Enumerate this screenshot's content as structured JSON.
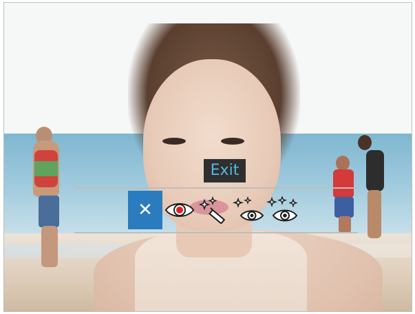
{
  "tooltip": {
    "text": "Exit"
  },
  "toolbar": {
    "tools": [
      {
        "name": "close",
        "icon": "close-icon",
        "active": true
      },
      {
        "name": "red-eye",
        "icon": "red-eye-icon",
        "active": false
      },
      {
        "name": "magic-wand",
        "icon": "magic-wand-icon",
        "active": false
      },
      {
        "name": "sparkle-eye",
        "icon": "sparkle-eye-icon",
        "active": false
      },
      {
        "name": "sparkle-eye-plus",
        "icon": "sparkle-eye-plus-icon",
        "active": false
      }
    ],
    "colors": {
      "active_bg": "#2a7cbf",
      "tooltip_bg": "#2f2f2f",
      "tooltip_text": "#55b6e4"
    }
  }
}
